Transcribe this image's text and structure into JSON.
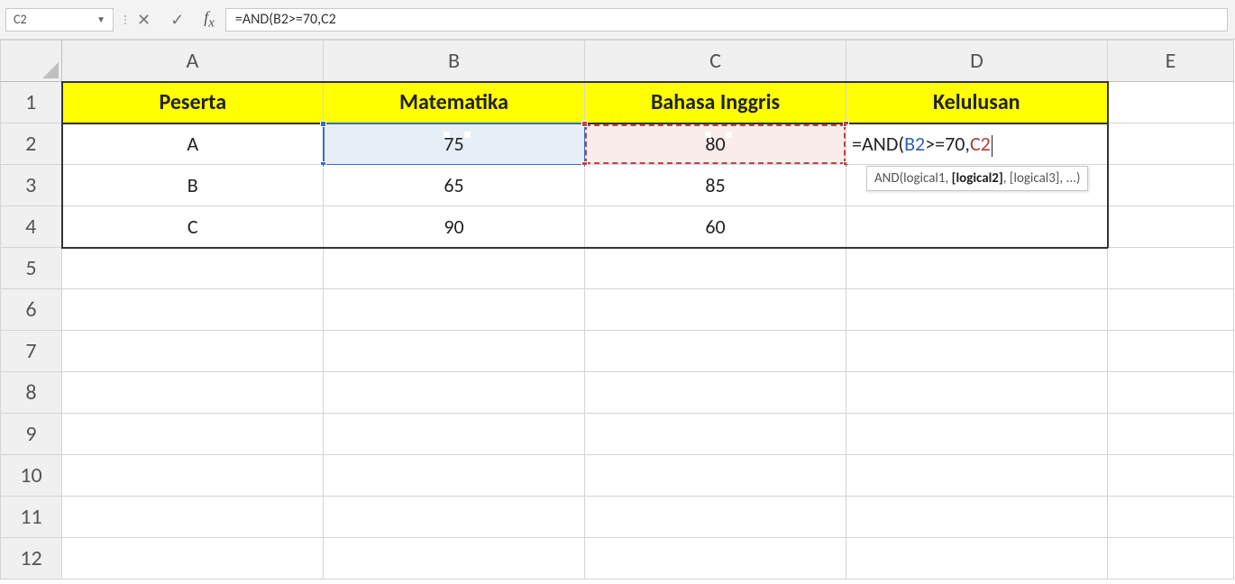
{
  "nameBox": "C2",
  "formulaBar": "=AND(B2>=70,C2",
  "columns": [
    "A",
    "B",
    "C",
    "D",
    "E"
  ],
  "rows": [
    "1",
    "2",
    "3",
    "4",
    "5",
    "6",
    "7",
    "8",
    "9",
    "10",
    "11",
    "12"
  ],
  "headers": {
    "A": "Peserta",
    "B": "Matematika",
    "C": "Bahasa Inggris",
    "D": "Kelulusan"
  },
  "data": {
    "r2": {
      "A": "A",
      "B": "75",
      "C": "80"
    },
    "r3": {
      "A": "B",
      "B": "65",
      "C": "85"
    },
    "r4": {
      "A": "C",
      "B": "90",
      "C": "60"
    }
  },
  "editFormula": {
    "p1": "=AND(",
    "p2": "B2",
    "p3": ">=70,",
    "p4": "C2"
  },
  "tooltip": {
    "fn": "AND",
    "arg1": "(logical1, ",
    "argB": "[logical2]",
    "argRest": ", [logical3], ...)"
  }
}
